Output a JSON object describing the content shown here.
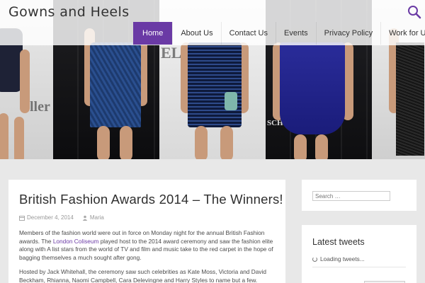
{
  "site": {
    "title": "Gowns and Heels",
    "accent": "#6a3aa5"
  },
  "nav": {
    "items": [
      {
        "label": "Home",
        "active": true
      },
      {
        "label": "About Us",
        "active": false
      },
      {
        "label": "Contact Us",
        "active": false
      },
      {
        "label": "Events",
        "active": false
      },
      {
        "label": "Privacy Policy",
        "active": false
      },
      {
        "label": "Work for Us",
        "active": false
      }
    ]
  },
  "icons": {
    "search": "search-icon",
    "calendar": "calendar-icon",
    "author": "user-icon",
    "loading": "loading-icon"
  },
  "hero": {
    "caption_1": "ller",
    "caption_2": "ELLE",
    "caption_3": "SCH"
  },
  "post": {
    "title": "British Fashion Awards 2014 – The Winners!",
    "date": "December 4, 2014",
    "author": "Maria",
    "para1_a": "Members of the fashion world were out in force on Monday night for the annual British Fashion awards. The ",
    "para1_link": "London Coliseum",
    "para1_b": " played host to the 2014 award ceremony and saw the fashion elite along with A list stars from the world of TV and film and music take to the red carpet in the hope of bagging themselves a much sought after gong.",
    "para2": "Hosted by Jack Whitehall, the ceremony saw such celebrities as Kate Moss, Victoria and David Beckham, Rhianna, Naomi Campbell, Cara Delevingne and Harry Styles to name but a few."
  },
  "sidebar": {
    "search_placeholder": "Search …",
    "tweets_title": "Latest tweets",
    "tweets_loading": "Loading tweets..."
  }
}
